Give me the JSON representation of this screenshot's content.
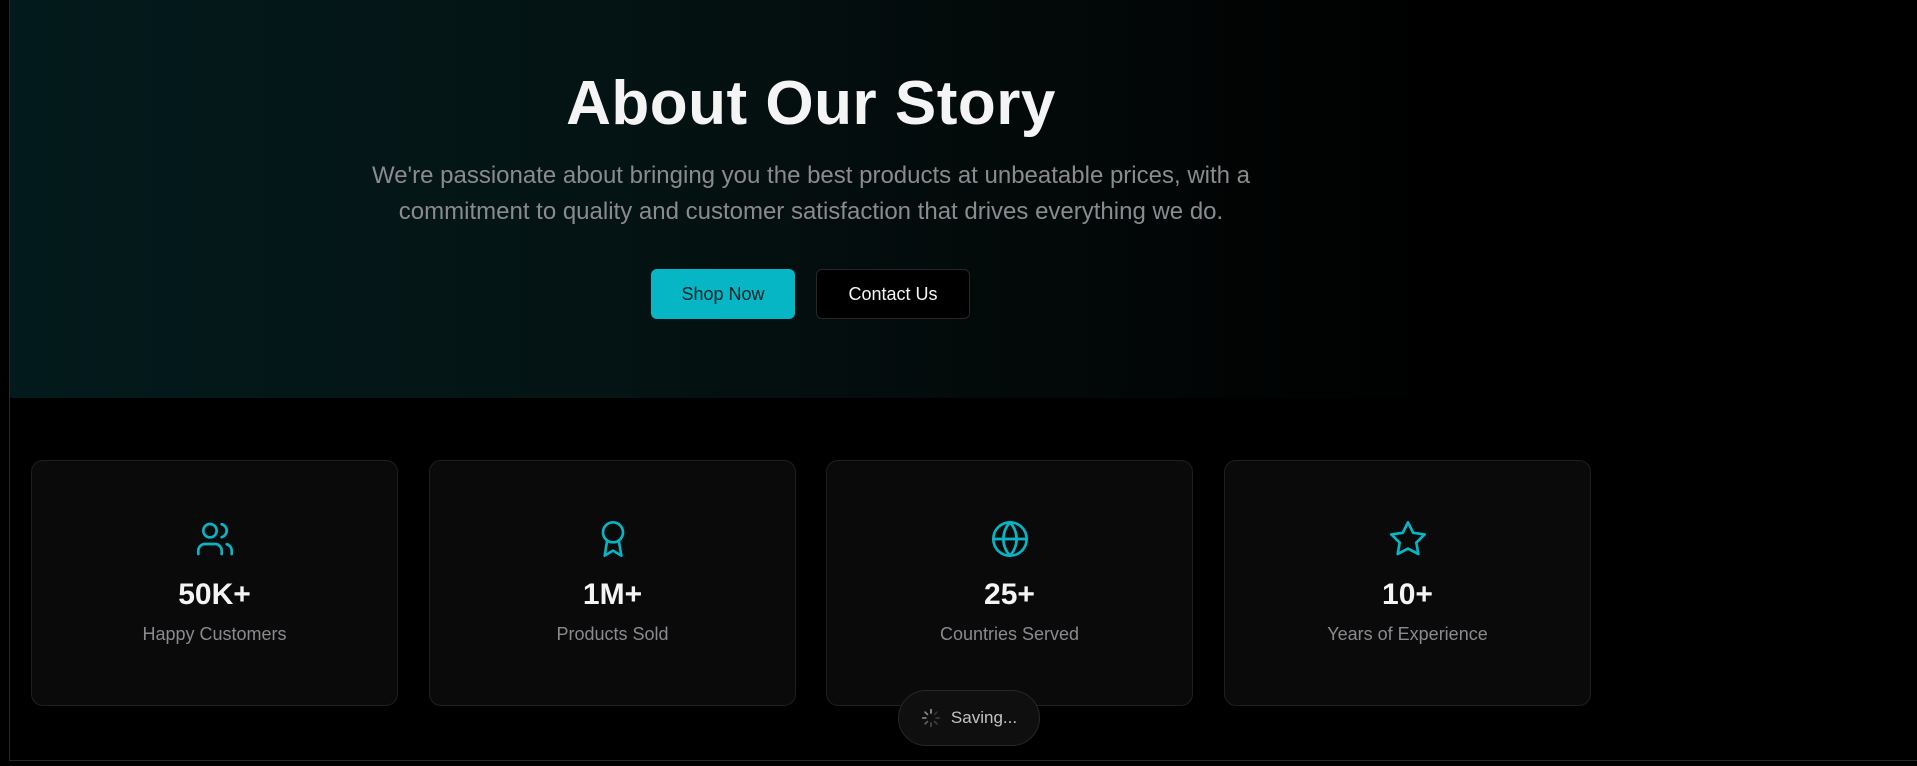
{
  "hero": {
    "title": "About Our Story",
    "subtitle": "We're passionate about bringing you the best products at unbeatable prices, with a commitment to quality and customer satisfaction that drives everything we do.",
    "primary_button": "Shop Now",
    "secondary_button": "Contact Us"
  },
  "stats": [
    {
      "icon": "users-icon",
      "value": "50K+",
      "label": "Happy Customers"
    },
    {
      "icon": "award-icon",
      "value": "1M+",
      "label": "Products Sold"
    },
    {
      "icon": "globe-icon",
      "value": "25+",
      "label": "Countries Served"
    },
    {
      "icon": "star-icon",
      "value": "10+",
      "label": "Years of Experience"
    }
  ],
  "toast": {
    "text": "Saving..."
  },
  "colors": {
    "accent": "#06b6c4",
    "background": "#000000",
    "card": "#0a0a0a",
    "muted_text": "#8a8a8f"
  }
}
